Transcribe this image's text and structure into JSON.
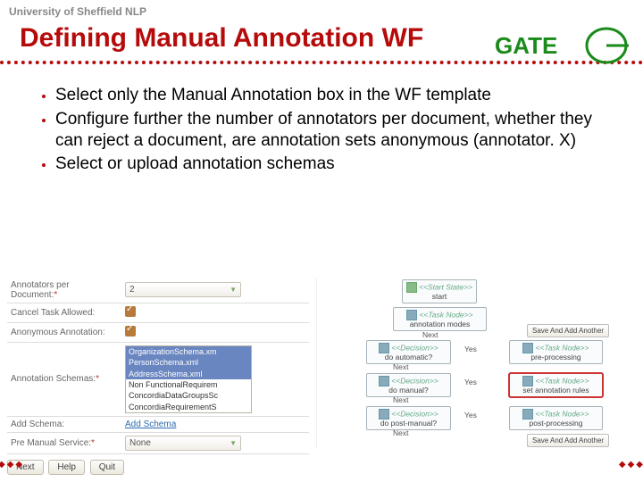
{
  "header": {
    "small": "University of Sheffield NLP",
    "title": "Defining Manual Annotation WF",
    "logo": "GATE"
  },
  "bullets": [
    "Select only the Manual Annotation box in the WF template",
    "Configure further the number of annotators per document, whether they can reject a document, are annotation sets anonymous (annotator. X)",
    "Select or upload annotation schemas"
  ],
  "form": {
    "r1_label": "Annotators per Document:",
    "r1_value": "2",
    "r2_label": "Cancel Task Allowed:",
    "r3_label": "Anonymous Annotation:",
    "r4_label": "Annotation Schemas:",
    "schema_items": [
      "OrganizationSchema.xm",
      "PersonSchema.xml",
      "AddressSchema.xml",
      "Non FunctionalRequirem",
      "ConcordiaDataGroupsSc",
      "ConcordiaRequirementS"
    ],
    "r5_label": "Add Schema:",
    "r5_link": "Add Schema",
    "r6_label": "Pre Manual Service:",
    "r6_value": "None",
    "btn_next": "Next",
    "btn_help": "Help",
    "btn_quit": "Quit",
    "star": "*"
  },
  "flow": {
    "start": {
      "t": "<<Start State>>",
      "l": "start"
    },
    "ann_modes": {
      "t": "<<Task Node>>",
      "l": "annotation modes"
    },
    "do_auto": {
      "t": "<<Decision>>",
      "l": "do automatic?"
    },
    "pre": {
      "t": "<<Task Node>>",
      "l": "pre-processing"
    },
    "do_man": {
      "t": "<<Decision>>",
      "l": "do manual?"
    },
    "rules": {
      "t": "<<Task Node>>",
      "l": "set annotation rules"
    },
    "do_post": {
      "t": "<<Decision>>",
      "l": "do post-manual?"
    },
    "post": {
      "t": "<<Task Node>>",
      "l": "post-processing"
    },
    "next": "Next",
    "yes": "Yes",
    "save": "Save And Add Another"
  }
}
